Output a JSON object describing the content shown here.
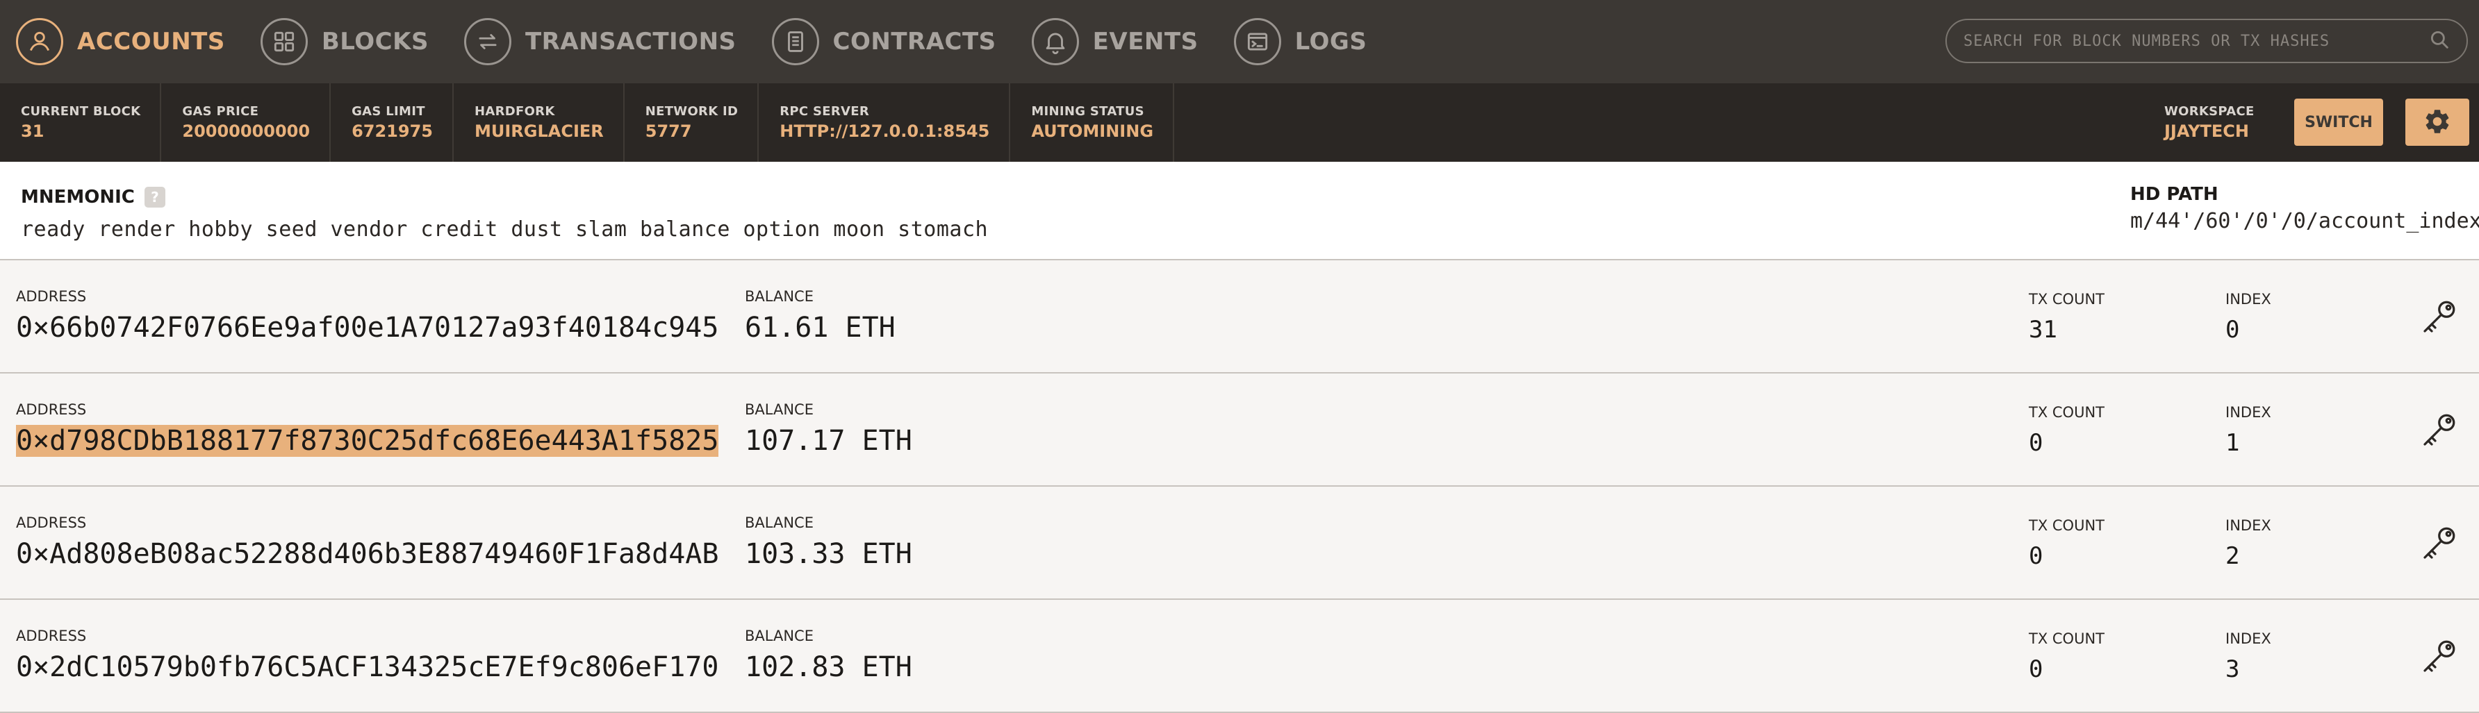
{
  "nav": {
    "items": [
      {
        "label": "ACCOUNTS",
        "icon": "person-icon",
        "active": true
      },
      {
        "label": "BLOCKS",
        "icon": "grid-icon",
        "active": false
      },
      {
        "label": "TRANSACTIONS",
        "icon": "swap-arrows-icon",
        "active": false
      },
      {
        "label": "CONTRACTS",
        "icon": "document-icon",
        "active": false
      },
      {
        "label": "EVENTS",
        "icon": "bell-icon",
        "active": false
      },
      {
        "label": "LOGS",
        "icon": "terminal-icon",
        "active": false
      }
    ],
    "search_placeholder": "SEARCH FOR BLOCK NUMBERS OR TX HASHES"
  },
  "status": {
    "current_block": {
      "label": "CURRENT BLOCK",
      "value": "31"
    },
    "gas_price": {
      "label": "GAS PRICE",
      "value": "20000000000"
    },
    "gas_limit": {
      "label": "GAS LIMIT",
      "value": "6721975"
    },
    "hardfork": {
      "label": "HARDFORK",
      "value": "MUIRGLACIER"
    },
    "network_id": {
      "label": "NETWORK ID",
      "value": "5777"
    },
    "rpc_server": {
      "label": "RPC SERVER",
      "value": "HTTP://127.0.0.1:8545"
    },
    "mining_status": {
      "label": "MINING STATUS",
      "value": "AUTOMINING"
    },
    "workspace": {
      "label": "WORKSPACE",
      "value": "JJAYTECH"
    },
    "switch_label": "SWITCH"
  },
  "mnemonic": {
    "title": "MNEMONIC",
    "help": "?",
    "words": "ready render hobby seed vendor credit dust slam balance option moon stomach",
    "hd_path_title": "HD PATH",
    "hd_path_value": "m/44'/60'/0'/0/account_index"
  },
  "accounts": {
    "labels": {
      "address": "ADDRESS",
      "balance": "BALANCE",
      "tx_count": "TX COUNT",
      "index": "INDEX"
    },
    "rows": [
      {
        "address": "0×66b0742F0766Ee9af00e1A70127a93f40184c945",
        "balance": "61.61 ETH",
        "tx_count": "31",
        "index": "0",
        "selected": false
      },
      {
        "address": "0×d798CDbB188177f8730C25dfc68E6e443A1f5825",
        "balance": "107.17 ETH",
        "tx_count": "0",
        "index": "1",
        "selected": true
      },
      {
        "address": "0×Ad808eB08ac52288d406b3E88749460F1Fa8d4AB",
        "balance": "103.33 ETH",
        "tx_count": "0",
        "index": "2",
        "selected": false
      },
      {
        "address": "0×2dC10579b0fb76C5ACF134325cE7Ef9c806eF170",
        "balance": "102.83 ETH",
        "tx_count": "0",
        "index": "3",
        "selected": false
      }
    ]
  },
  "colors": {
    "accent": "#e8b17c",
    "nav_bg": "#3c3834",
    "status_bg": "#2b2724"
  }
}
